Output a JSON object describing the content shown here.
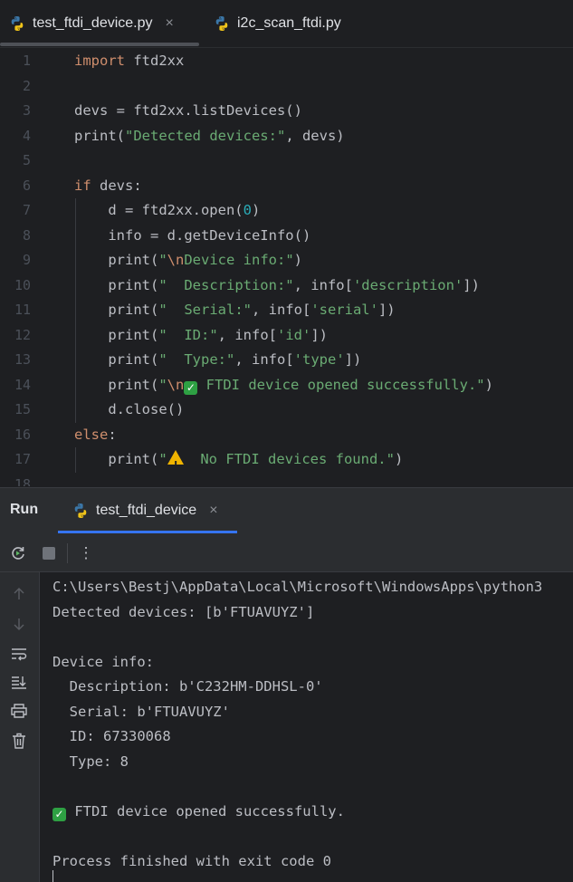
{
  "tabs": [
    {
      "label": "test_ftdi_device.py",
      "active": true,
      "icon": "python-icon"
    },
    {
      "label": "i2c_scan_ftdi.py",
      "active": false,
      "icon": "python-icon"
    }
  ],
  "close_glyph": "×",
  "editor": {
    "lines": [
      {
        "n": "1",
        "parts": [
          {
            "c": "kw",
            "t": "import"
          },
          {
            "c": "",
            "t": " ftd2xx"
          }
        ]
      },
      {
        "n": "2",
        "parts": []
      },
      {
        "n": "3",
        "parts": [
          {
            "c": "",
            "t": "devs = ftd2xx.listDevices()"
          }
        ]
      },
      {
        "n": "4",
        "parts": [
          {
            "c": "",
            "t": "print("
          },
          {
            "c": "str",
            "t": "\"Detected devices:\""
          },
          {
            "c": "",
            "t": ", devs)"
          }
        ]
      },
      {
        "n": "5",
        "parts": []
      },
      {
        "n": "6",
        "parts": [
          {
            "c": "kw",
            "t": "if"
          },
          {
            "c": "",
            "t": " devs:"
          }
        ]
      },
      {
        "n": "7",
        "parts": [
          {
            "c": "",
            "t": "    d = ftd2xx.open("
          },
          {
            "c": "num",
            "t": "0"
          },
          {
            "c": "",
            "t": ")"
          }
        ]
      },
      {
        "n": "8",
        "parts": [
          {
            "c": "",
            "t": "    info = d.getDeviceInfo()"
          }
        ]
      },
      {
        "n": "9",
        "parts": [
          {
            "c": "",
            "t": "    print("
          },
          {
            "c": "str",
            "t": "\""
          },
          {
            "c": "esc",
            "t": "\\n"
          },
          {
            "c": "str",
            "t": "Device info:\""
          },
          {
            "c": "",
            "t": ")"
          }
        ]
      },
      {
        "n": "10",
        "parts": [
          {
            "c": "",
            "t": "    print("
          },
          {
            "c": "str",
            "t": "\"  Description:\""
          },
          {
            "c": "",
            "t": ", info["
          },
          {
            "c": "str",
            "t": "'description'"
          },
          {
            "c": "",
            "t": "])"
          }
        ]
      },
      {
        "n": "11",
        "parts": [
          {
            "c": "",
            "t": "    print("
          },
          {
            "c": "str",
            "t": "\"  Serial:\""
          },
          {
            "c": "",
            "t": ", info["
          },
          {
            "c": "str",
            "t": "'serial'"
          },
          {
            "c": "",
            "t": "])"
          }
        ]
      },
      {
        "n": "12",
        "parts": [
          {
            "c": "",
            "t": "    print("
          },
          {
            "c": "str",
            "t": "\"  ID:\""
          },
          {
            "c": "",
            "t": ", info["
          },
          {
            "c": "str",
            "t": "'id'"
          },
          {
            "c": "",
            "t": "])"
          }
        ]
      },
      {
        "n": "13",
        "parts": [
          {
            "c": "",
            "t": "    print("
          },
          {
            "c": "str",
            "t": "\"  Type:\""
          },
          {
            "c": "",
            "t": ", info["
          },
          {
            "c": "str",
            "t": "'type'"
          },
          {
            "c": "",
            "t": "])"
          }
        ]
      },
      {
        "n": "14",
        "parts": [
          {
            "c": "",
            "t": "    print("
          },
          {
            "c": "str",
            "t": "\""
          },
          {
            "c": "esc",
            "t": "\\n"
          },
          {
            "c": "check",
            "t": "✓"
          },
          {
            "c": "str",
            "t": " FTDI device opened successfully.\""
          },
          {
            "c": "",
            "t": ")"
          }
        ]
      },
      {
        "n": "15",
        "parts": [
          {
            "c": "",
            "t": "    d.close()"
          }
        ]
      },
      {
        "n": "16",
        "parts": [
          {
            "c": "kw",
            "t": "else"
          },
          {
            "c": "",
            "t": ":"
          }
        ]
      },
      {
        "n": "17",
        "parts": [
          {
            "c": "",
            "t": "    print("
          },
          {
            "c": "str",
            "t": "\""
          },
          {
            "c": "warn",
            "t": "!"
          },
          {
            "c": "str",
            "t": "  No FTDI devices found.\""
          },
          {
            "c": "",
            "t": ")"
          }
        ]
      },
      {
        "n": "18",
        "parts": []
      }
    ]
  },
  "run_panel": {
    "title": "Run",
    "config_tab": "test_ftdi_device",
    "toolbar": {
      "rerun": "⟳",
      "stop": "■",
      "more": "⋮"
    },
    "console_lines": [
      {
        "text": "C:\\Users\\Bestj\\AppData\\Local\\Microsoft\\WindowsApps\\python3"
      },
      {
        "text": "Detected devices: [b'FTUAVUYZ']"
      },
      {
        "text": ""
      },
      {
        "text": "Device info:"
      },
      {
        "text": "  Description: b'C232HM-DDHSL-0'"
      },
      {
        "text": "  Serial: b'FTUAVUYZ'"
      },
      {
        "text": "  ID: 67330068"
      },
      {
        "text": "  Type: 8"
      },
      {
        "text": ""
      },
      {
        "text": " FTDI device opened successfully.",
        "check": "✓"
      },
      {
        "text": ""
      },
      {
        "text": "Process finished with exit code 0"
      }
    ]
  },
  "colors": {
    "keyword": "#cf8e6d",
    "string": "#6aab73",
    "number": "#2aacb8",
    "accent": "#3574f0",
    "check": "#2ea043",
    "warning": "#f0b400"
  }
}
